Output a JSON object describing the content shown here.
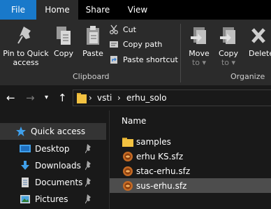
{
  "tabs": {
    "file": "File",
    "home": "Home",
    "share": "Share",
    "view": "View"
  },
  "ribbon": {
    "pin_label_1": "Pin to Quick",
    "pin_label_2": "access",
    "copy": "Copy",
    "paste": "Paste",
    "cut": "Cut",
    "copy_path": "Copy path",
    "paste_shortcut": "Paste shortcut",
    "clipboard_group": "Clipboard",
    "move_to_1": "Move",
    "move_to_2": "to",
    "copy_to_1": "Copy",
    "copy_to_2": "to",
    "delete": "Delete",
    "organize_group": "Organize"
  },
  "nav": {
    "breadcrumbs": [
      "vsti",
      "erhu_solo"
    ]
  },
  "sidebar": {
    "items": [
      {
        "label": "Quick access",
        "icon": "star-icon"
      },
      {
        "label": "Desktop",
        "icon": "desktop-icon"
      },
      {
        "label": "Downloads",
        "icon": "download-icon"
      },
      {
        "label": "Documents",
        "icon": "document-icon"
      },
      {
        "label": "Pictures",
        "icon": "pictures-icon"
      }
    ]
  },
  "filelist": {
    "header_name": "Name",
    "files": [
      {
        "name": "samples",
        "icon": "folder-icon"
      },
      {
        "name": "erhu KS.sfz",
        "icon": "sfz-file-icon"
      },
      {
        "name": "stac-erhu.sfz",
        "icon": "sfz-file-icon"
      },
      {
        "name": "sus-erhu.sfz",
        "icon": "sfz-file-icon"
      }
    ]
  },
  "colors": {
    "file_tab": "#1979ca",
    "ribbon_bg": "#2b2b2b",
    "window_bg": "#191919",
    "selected_row": "#4d4d4d",
    "folder_yellow": "#f3c241",
    "quick_access_star": "#3f9fea"
  }
}
